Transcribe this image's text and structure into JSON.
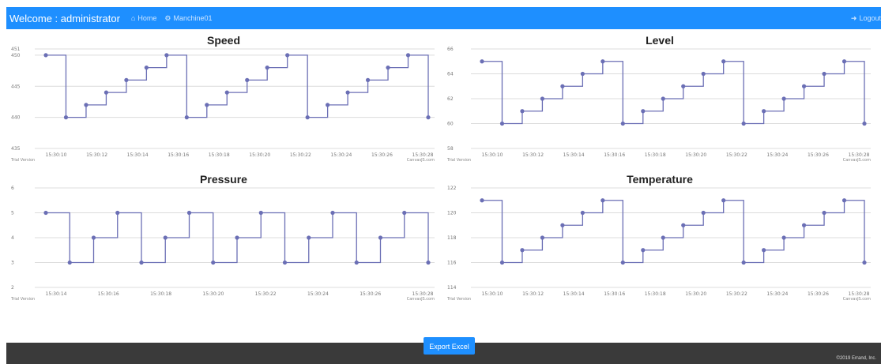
{
  "nav": {
    "brand": "Welcome : administrator",
    "home_label": "Home",
    "machine_label": "Manchine01",
    "logout_label": "Logout",
    "home_icon": "home-icon",
    "machine_icon": "gear-icon",
    "logout_icon": "logout-icon"
  },
  "chart_data": [
    {
      "type": "line",
      "step": true,
      "title": "Speed",
      "ylim": [
        435,
        451
      ],
      "yticks": [
        451,
        450,
        445,
        440,
        435
      ],
      "xticks": [
        "15:30:10",
        "15:30:12",
        "15:30:14",
        "15:30:16",
        "15:30:18",
        "15:30:20",
        "15:30:22",
        "15:30:24",
        "15:30:26",
        "15:30:28"
      ],
      "values": [
        450,
        440,
        442,
        444,
        446,
        448,
        450,
        440,
        442,
        444,
        446,
        448,
        450,
        440,
        442,
        444,
        446,
        448,
        450,
        440
      ],
      "credit_left": "Trial Version",
      "credit_right": "CanvasJS.com",
      "color": "#6b6fb5"
    },
    {
      "type": "line",
      "step": true,
      "title": "Level",
      "ylim": [
        58,
        66
      ],
      "yticks": [
        66,
        64,
        62,
        60,
        58
      ],
      "xticks": [
        "15:30:10",
        "15:30:12",
        "15:30:14",
        "15:30:16",
        "15:30:18",
        "15:30:20",
        "15:30:22",
        "15:30:24",
        "15:30:26",
        "15:30:28"
      ],
      "values": [
        65,
        60,
        61,
        62,
        63,
        64,
        65,
        60,
        61,
        62,
        63,
        64,
        65,
        60,
        61,
        62,
        63,
        64,
        65,
        60
      ],
      "credit_left": "Trial Version",
      "credit_right": "CanvasJS.com",
      "color": "#6b6fb5"
    },
    {
      "type": "line",
      "step": true,
      "title": "Pressure",
      "ylim": [
        2,
        6
      ],
      "yticks": [
        6,
        5,
        4,
        3,
        2
      ],
      "xticks": [
        "15:30:14",
        "15:30:16",
        "15:30:18",
        "15:30:20",
        "15:30:22",
        "15:30:24",
        "15:30:26",
        "15:30:28"
      ],
      "values": [
        5,
        3,
        4,
        5,
        3,
        4,
        5,
        3,
        4,
        5,
        3,
        4,
        5,
        3,
        4,
        5,
        3
      ],
      "credit_left": "Trial Version",
      "credit_right": "CanvasJS.com",
      "color": "#6b6fb5"
    },
    {
      "type": "line",
      "step": true,
      "title": "Temperature",
      "ylim": [
        114,
        122
      ],
      "yticks": [
        122,
        120,
        118,
        116,
        114
      ],
      "xticks": [
        "15:30:10",
        "15:30:12",
        "15:30:14",
        "15:30:16",
        "15:30:18",
        "15:30:20",
        "15:30:22",
        "15:30:24",
        "15:30:26",
        "15:30:28"
      ],
      "values": [
        121,
        116,
        117,
        118,
        119,
        120,
        121,
        116,
        117,
        118,
        119,
        120,
        121,
        116,
        117,
        118,
        119,
        120,
        121,
        116
      ],
      "credit_left": "Trial Version",
      "credit_right": "CanvasJS.com",
      "color": "#6b6fb5"
    }
  ],
  "export_label": "Export Excel",
  "footer_text": "©2019 Errand, Inc."
}
